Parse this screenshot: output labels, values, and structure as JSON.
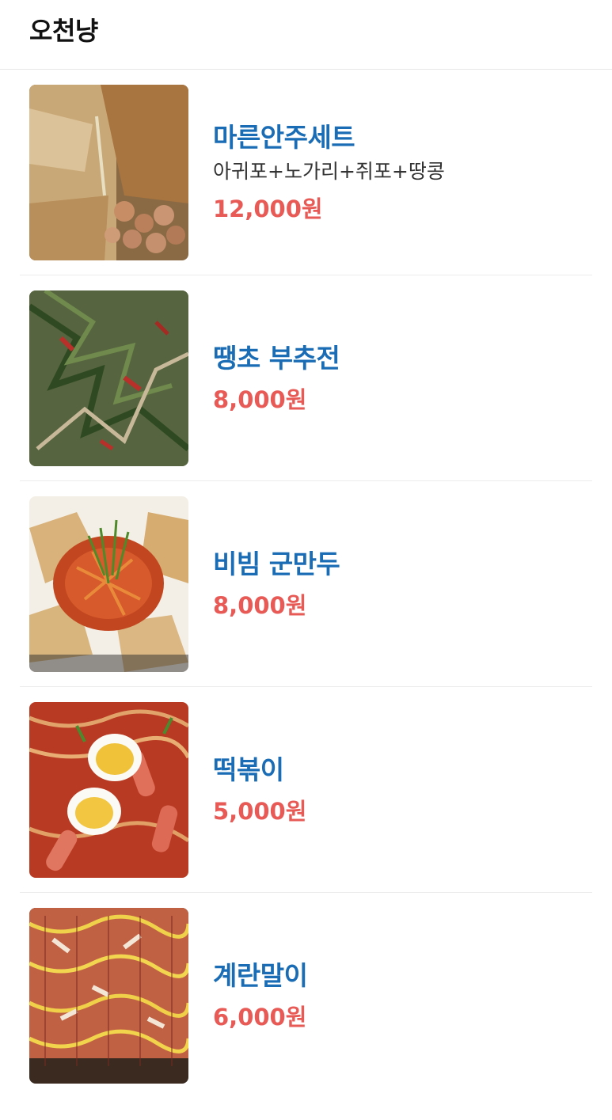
{
  "header": {
    "title": "오천냥"
  },
  "menu": [
    {
      "name": "마른안주세트",
      "desc": "아귀포+노가리+쥐포+땅콩",
      "price": "12,000원",
      "image": "dried-snack-set-photo"
    },
    {
      "name": "땡초 부추전",
      "desc": "",
      "price": "8,000원",
      "image": "chive-pancake-photo"
    },
    {
      "name": "비빔 군만두",
      "desc": "",
      "price": "8,000원",
      "image": "spicy-fried-dumplings-photo"
    },
    {
      "name": "떡볶이",
      "desc": "",
      "price": "5,000원",
      "image": "tteokbokki-photo"
    },
    {
      "name": "계란말이",
      "desc": "",
      "price": "6,000원",
      "image": "rolled-omelette-photo"
    }
  ]
}
